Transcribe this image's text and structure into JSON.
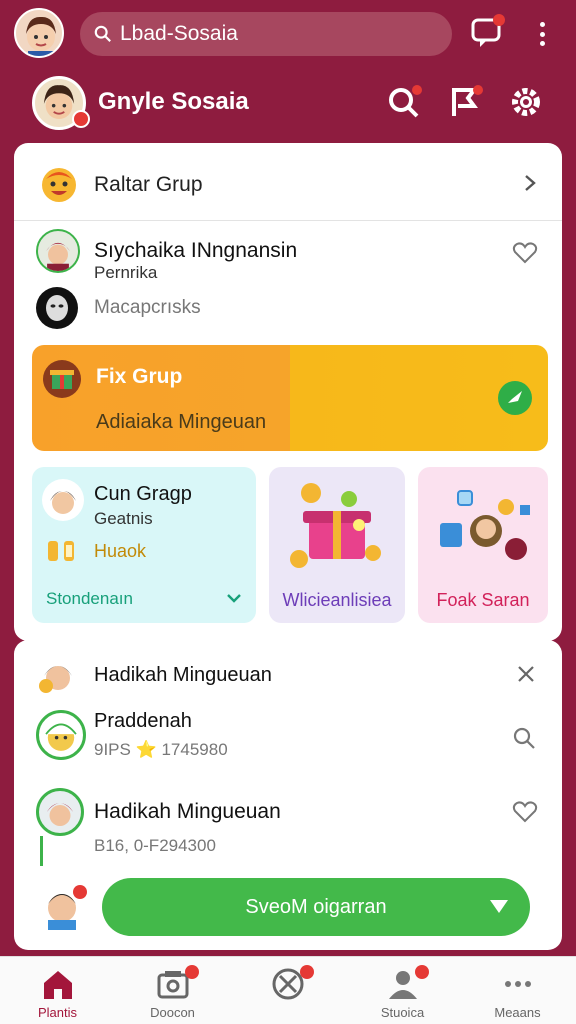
{
  "topbar": {
    "search_text": "Lbad-Sosaia",
    "chat_badge": "1"
  },
  "profile": {
    "name": "Gnyle Sosaia"
  },
  "group_row": {
    "label": "Raltar Grup"
  },
  "friends": [
    {
      "name": "Sıychaika INngnansin",
      "sub": "Pernrika"
    },
    {
      "name": "Macapcrısks",
      "sub": ""
    }
  ],
  "fix_banner": {
    "title": "Fix Grup",
    "subtitle": "Adiaiaka Mingeuan"
  },
  "tiles": [
    {
      "title": "Cun Gragp",
      "sub": "Geatnis",
      "amount": "Huaok",
      "footer": "Stondenaın",
      "footer_color": "#17a07a"
    },
    {
      "footer": "Wlicieanlisiea",
      "footer_color": "#6d3db8"
    },
    {
      "footer": "Foak Saran",
      "footer_color": "#d2225a"
    }
  ],
  "weekly": {
    "header": "Hadikah Mingueuan",
    "entries": [
      {
        "name": "Praddenah",
        "score": "9IPS ⭐ 1745980"
      },
      {
        "name": "Hadikah Mingueuan",
        "score": "B16, 0-F294300"
      }
    ],
    "send_button": "SveoM oigarran"
  },
  "bottom_nav": [
    {
      "label": "Plantis",
      "active": true
    },
    {
      "label": "Doocon",
      "active": false
    },
    {
      "label": "",
      "active": false
    },
    {
      "label": "Stuoica",
      "active": false
    },
    {
      "label": "Meaans",
      "active": false
    }
  ],
  "colors": {
    "brand": "#8e1c3f",
    "accent_green": "#43b94a",
    "orange": "#f8a12a"
  }
}
